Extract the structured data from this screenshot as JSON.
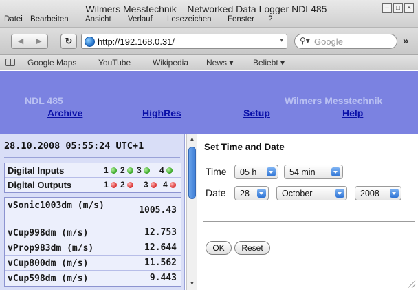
{
  "window": {
    "title": "Wilmers Messtechnik – Networked Data Logger NDL485",
    "controls": [
      "minimize",
      "maximize",
      "close"
    ]
  },
  "menu": [
    "Datei",
    "Bearbeiten",
    "Ansicht",
    "Verlauf",
    "Lesezeichen",
    "Fenster",
    "?"
  ],
  "nav": {
    "url": "http://192.168.0.31/",
    "search_placeholder": "Google",
    "overflow": "»"
  },
  "bookmarks": [
    "Google Maps",
    "YouTube",
    "Wikipedia",
    "News ▾",
    "Beliebt ▾"
  ],
  "header": {
    "product": "NDL 485",
    "company": "Wilmers Messtechnik",
    "links": [
      "Archive",
      "HighRes",
      "Setup",
      "Help"
    ],
    "colors": {
      "background": "#7b82e1",
      "link": "#0a10a8",
      "muted": "#b9c0f2"
    }
  },
  "status": {
    "datetime": "28.10.2008 05:55:24 UTC+1",
    "digital_inputs": {
      "label": "Digital Inputs",
      "channels": [
        {
          "num": "1",
          "state": "green"
        },
        {
          "num": "2",
          "state": "green"
        },
        {
          "num": "3",
          "state": "green"
        },
        {
          "num": "4",
          "state": "green"
        }
      ]
    },
    "digital_outputs": {
      "label": "Digital Outputs",
      "channels": [
        {
          "num": "1",
          "state": "red"
        },
        {
          "num": "2",
          "state": "red"
        },
        {
          "num": "3",
          "state": "red"
        },
        {
          "num": "4",
          "state": "red"
        }
      ]
    },
    "measurements": [
      {
        "name": "vSonic1003dm (m/s)",
        "value": "1005.43"
      },
      {
        "name": "vCup998dm (m/s)",
        "value": "12.753"
      },
      {
        "name": "vProp983dm (m/s)",
        "value": "12.644"
      },
      {
        "name": "vCup800dm (m/s)",
        "value": "11.562"
      },
      {
        "name": "vCup598dm (m/s)",
        "value": "9.443"
      }
    ]
  },
  "form": {
    "title": "Set Time and Date",
    "time_label": "Time",
    "date_label": "Date",
    "hour": "05 h",
    "minute": "54 min",
    "day": "28",
    "month": "October",
    "year": "2008",
    "ok_label": "OK",
    "reset_label": "Reset"
  }
}
